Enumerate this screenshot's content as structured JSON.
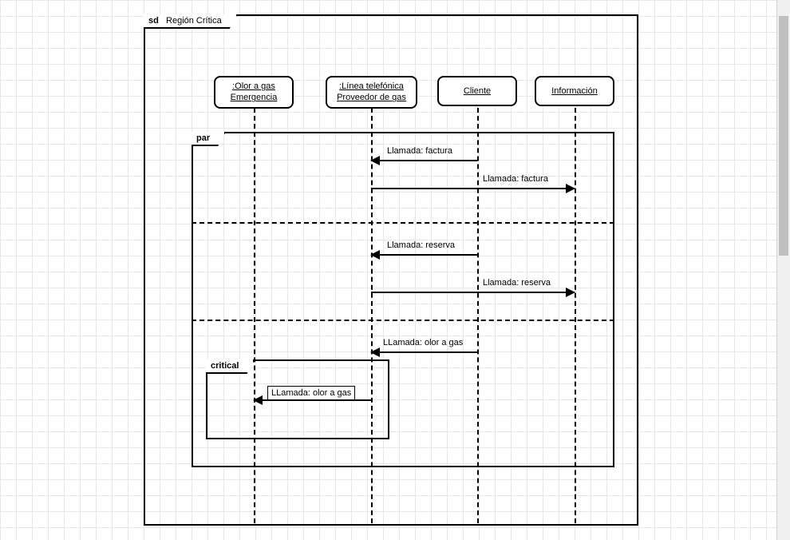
{
  "frame": {
    "sd_prefix": "sd",
    "title": "Región Crítica",
    "par_label": "par",
    "critical_label": "critical"
  },
  "participants": {
    "p1": ":Olor a gas Emergencia",
    "p2_line1": ":Línea telefónica",
    "p2_line2": "Proveedor de gas",
    "p3": "Cliente",
    "p4": "Información"
  },
  "messages": {
    "m1": "Llamada: factura",
    "m2": "Llamada: factura",
    "m3": "Llamada: reserva",
    "m4": "Llamada: reserva",
    "m5": "LLamada: olor a gas",
    "m6": "LLamada: olor a gas"
  },
  "chart_data": {
    "type": "sequence_diagram",
    "title": "Región Crítica",
    "lifelines": [
      {
        "id": "olor_gas_emergencia",
        "label": ":Olor a gas Emergencia"
      },
      {
        "id": "linea_telefonica",
        "label": ":Línea telefónica Proveedor de gas"
      },
      {
        "id": "cliente",
        "label": "Cliente"
      },
      {
        "id": "informacion",
        "label": "Información"
      }
    ],
    "fragments": [
      {
        "operator": "par",
        "operands": [
          {
            "messages": [
              {
                "from": "cliente",
                "to": "linea_telefonica",
                "label": "Llamada: factura"
              },
              {
                "from": "linea_telefonica",
                "to": "informacion",
                "label": "Llamada: factura"
              }
            ]
          },
          {
            "messages": [
              {
                "from": "cliente",
                "to": "linea_telefonica",
                "label": "Llamada: reserva"
              },
              {
                "from": "linea_telefonica",
                "to": "informacion",
                "label": "Llamada: reserva"
              }
            ]
          },
          {
            "messages": [
              {
                "from": "cliente",
                "to": "linea_telefonica",
                "label": "LLamada: olor a gas"
              }
            ],
            "nested": {
              "operator": "critical",
              "messages": [
                {
                  "from": "linea_telefonica",
                  "to": "olor_gas_emergencia",
                  "label": "LLamada: olor a gas"
                }
              ]
            }
          }
        ]
      }
    ]
  }
}
